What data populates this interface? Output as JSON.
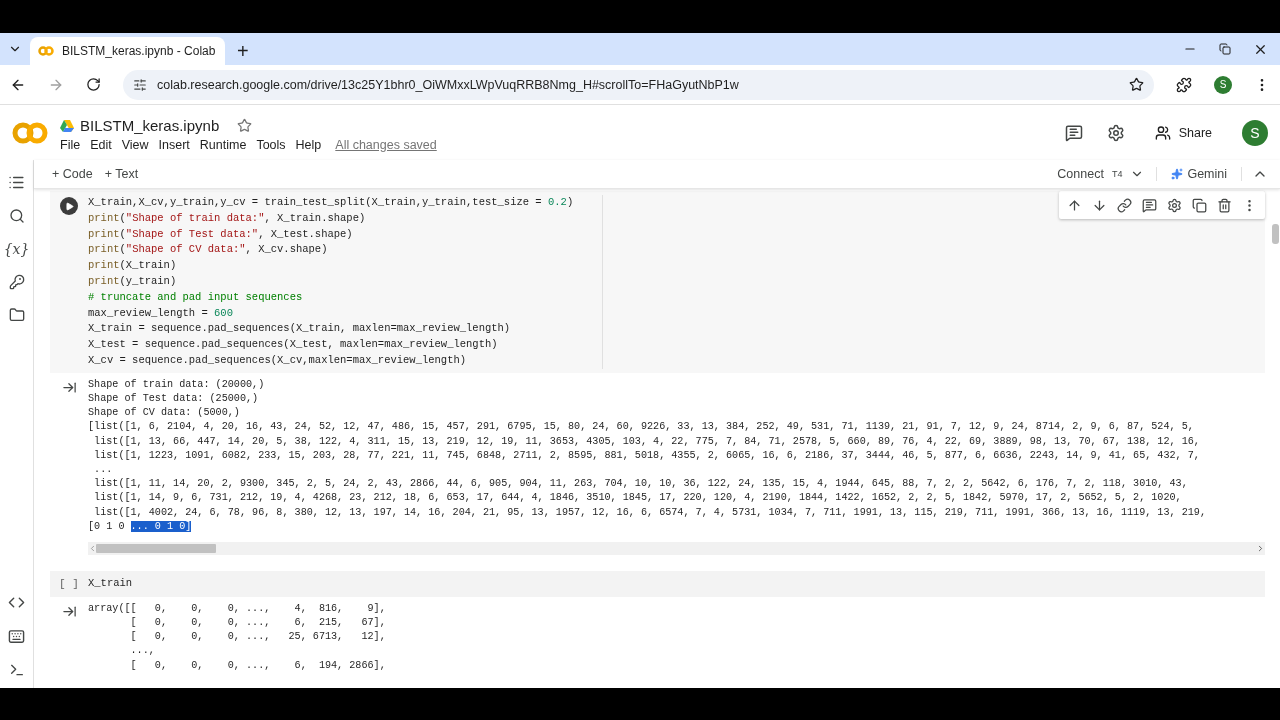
{
  "browser": {
    "tab_title": "BILSTM_keras.ipynb - Colab",
    "new_tab": "+",
    "url": "colab.research.google.com/drive/13c25Y1bhr0_OiWMxxLWpVuqRRB8Nmg_H#scrollTo=FHaGyutNbP1w",
    "profile_initial": "S"
  },
  "notebook": {
    "name": "BILSTM_keras.ipynb",
    "starred": false,
    "menu": [
      "File",
      "Edit",
      "View",
      "Insert",
      "Runtime",
      "Tools",
      "Help"
    ],
    "save_status": "All changes saved",
    "share": "Share",
    "avatar_initial": "S"
  },
  "toolbar": {
    "add_code": "+ Code",
    "add_text": "+ Text",
    "connect": "Connect",
    "runtime": "T4",
    "gemini": "Gemini"
  },
  "sidebar": {
    "variables_label": "{x}"
  },
  "cells": [
    {
      "focused": true,
      "code": [
        {
          "kind": "code",
          "text": "X_train,X_cv,y_train,y_cv = train_test_split(X_train,y_train,test_size = 0.2)"
        },
        {
          "kind": "code",
          "text": "print(\"Shape of train data:\", X_train.shape)"
        },
        {
          "kind": "code",
          "text": "print(\"Shape of Test data:\", X_test.shape)"
        },
        {
          "kind": "code",
          "text": "print(\"Shape of CV data:\", X_cv.shape)"
        },
        {
          "kind": "code",
          "text": "print(X_train)"
        },
        {
          "kind": "code",
          "text": "print(y_train)"
        },
        {
          "kind": "comment",
          "text": "# truncate and pad input sequences"
        },
        {
          "kind": "code",
          "text": "max_review_length = 600"
        },
        {
          "kind": "code",
          "text": "X_train = sequence.pad_sequences(X_train, maxlen=max_review_length)"
        },
        {
          "kind": "code",
          "text": "X_test = sequence.pad_sequences(X_test, maxlen=max_review_length)"
        },
        {
          "kind": "code",
          "text": "X_cv = sequence.pad_sequences(X_cv,maxlen=max_review_length)"
        }
      ],
      "output": [
        {
          "text": "Shape of train data: (20000,)"
        },
        {
          "text": "Shape of Test data: (25000,)"
        },
        {
          "text": "Shape of CV data: (5000,)"
        },
        {
          "text": "[list([1, 6, 2104, 4, 20, 16, 43, 24, 52, 12, 47, 486, 15, 457, 291, 6795, 15, 80, 24, 60, 9226, 33, 13, 384, 252, 49, 531, 71, 1139, 21, 91, 7, 12, 9, 24, 8714, 2, 9, 6, 87, 524, 5,"
        },
        {
          "text": " list([1, 13, 66, 447, 14, 20, 5, 38, 122, 4, 311, 15, 13, 219, 12, 19, 11, 3653, 4305, 103, 4, 22, 775, 7, 84, 71, 2578, 5, 660, 89, 76, 4, 22, 69, 3889, 98, 13, 70, 67, 138, 12, 16,"
        },
        {
          "text": " list([1, 1223, 1091, 6082, 233, 15, 203, 28, 77, 221, 11, 745, 6848, 2711, 2, 8595, 881, 5018, 4355, 2, 6065, 16, 6, 2186, 37, 3444, 46, 5, 877, 6, 6636, 2243, 14, 9, 41, 65, 432, 7,"
        },
        {
          "text": " ..."
        },
        {
          "text": " list([1, 11, 14, 20, 2, 9300, 345, 2, 5, 24, 2, 43, 2866, 44, 6, 905, 904, 11, 263, 704, 10, 10, 36, 122, 24, 135, 15, 4, 1944, 645, 88, 7, 2, 2, 5642, 6, 176, 7, 2, 118, 3010, 43,"
        },
        {
          "text": " list([1, 14, 9, 6, 731, 212, 19, 4, 4268, 23, 212, 18, 6, 653, 17, 644, 4, 1846, 3510, 1845, 17, 220, 120, 4, 2190, 1844, 1422, 1652, 2, 2, 5, 1842, 5970, 17, 2, 5652, 5, 2, 1020,"
        },
        {
          "text": " list([1, 4002, 24, 6, 78, 96, 8, 380, 12, 13, 197, 14, 16, 204, 21, 95, 13, 1957, 12, 16, 6, 6574, 7, 4, 5731, 1034, 7, 711, 1991, 13, 115, 219, 711, 1991, 366, 13, 16, 1119, 13, 219,"
        },
        {
          "text": "[0 1 0 ",
          "selected_text": "... 0 1 0]"
        }
      ]
    },
    {
      "focused": false,
      "run_label": "[ ]",
      "code": [
        {
          "kind": "code",
          "text": "X_train"
        }
      ],
      "output": [
        {
          "text": "array([[   0,    0,    0, ...,    4,  816,    9],"
        },
        {
          "text": "       [   0,    0,    0, ...,    6,  215,   67],"
        },
        {
          "text": "       [   0,    0,    0, ...,   25, 6713,   12],"
        },
        {
          "text": "       ...,"
        },
        {
          "text": "       [   0,    0,    0, ...,    6,  194, 2866],"
        }
      ]
    }
  ]
}
